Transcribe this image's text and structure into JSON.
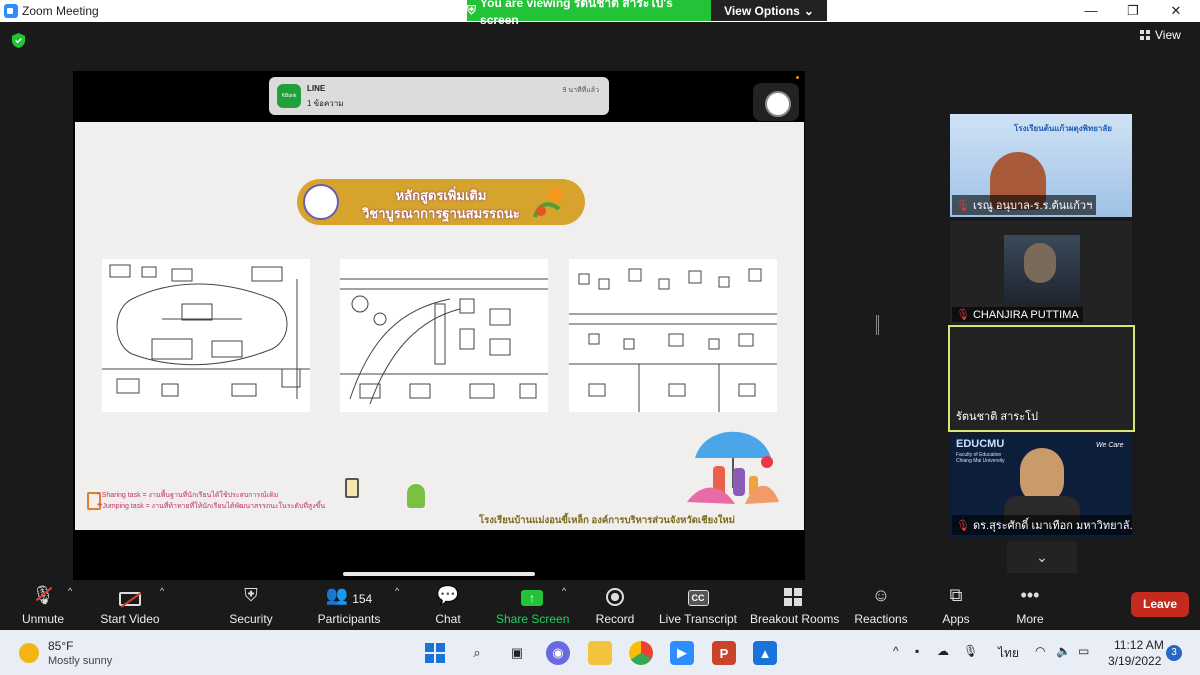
{
  "window": {
    "title": "Zoom Meeting",
    "viewing_banner": "You are viewing รัตนชาติ สาระโป's screen",
    "view_options": "View Options",
    "view_label": "View"
  },
  "shared_screen": {
    "notification": {
      "app": "LINE",
      "message": "1 ข้อความ",
      "time": "9 นาทีที่แล้ว",
      "icon_text": "KBank"
    },
    "slide": {
      "title_line1": "หลักสูตรเพิ่มเติม",
      "title_line2": "วิชาบูรณาการฐานสมรรถนะ",
      "note_line1": "* Sharing task = งานพื้นฐานที่นักเรียนได้ใช้ประสบการณ์เดิม",
      "note_line2": "**Jumping task = งานที่ท้าทายที่ให้นักเรียนได้พัฒนาสรรถนะในระดับที่สูงขึ้น",
      "school": "โรงเรียนบ้านแม่งอนขี้เหล็ก องค์การบริหารส่วนจังหวัดเชียงใหม่"
    }
  },
  "participants": [
    {
      "name": "เรณู อนุบาล-ร.ร.ต้นแก้วฯ",
      "muted": true,
      "overlay_text": "โรงเรียนต้นแก้วผดุงพิทยาลัย"
    },
    {
      "name": "CHANJIRA PUTTIMA",
      "muted": true
    },
    {
      "name": "รัตนชาติ สาระโป",
      "muted": false,
      "active": true
    },
    {
      "name": "ดร.สุระศักดิ์ เมาเทือก มหาวิทยาลั...",
      "muted": true,
      "overlay_text": "EDUCMU",
      "overlay_sub": "Faculty of Education Chiang Mai University",
      "overlay_tag": "We Care"
    }
  ],
  "toolbar": {
    "unmute": "Unmute",
    "start_video": "Start Video",
    "security": "Security",
    "participants": "Participants",
    "participants_count": "154",
    "chat": "Chat",
    "share_screen": "Share Screen",
    "record": "Record",
    "live_transcript": "Live Transcript",
    "live_transcript_badge": "CC",
    "breakout_rooms": "Breakout Rooms",
    "reactions": "Reactions",
    "apps": "Apps",
    "more": "More",
    "leave": "Leave"
  },
  "taskbar": {
    "temperature": "85°F",
    "condition": "Mostly sunny",
    "language": "ไทย",
    "time": "11:12 AM",
    "date": "3/19/2022",
    "notifications": "3"
  },
  "colors": {
    "banner_green": "#23c337",
    "share_green": "#23d160",
    "leave_red": "#c42b1c",
    "active_speaker": "#d8e675"
  }
}
